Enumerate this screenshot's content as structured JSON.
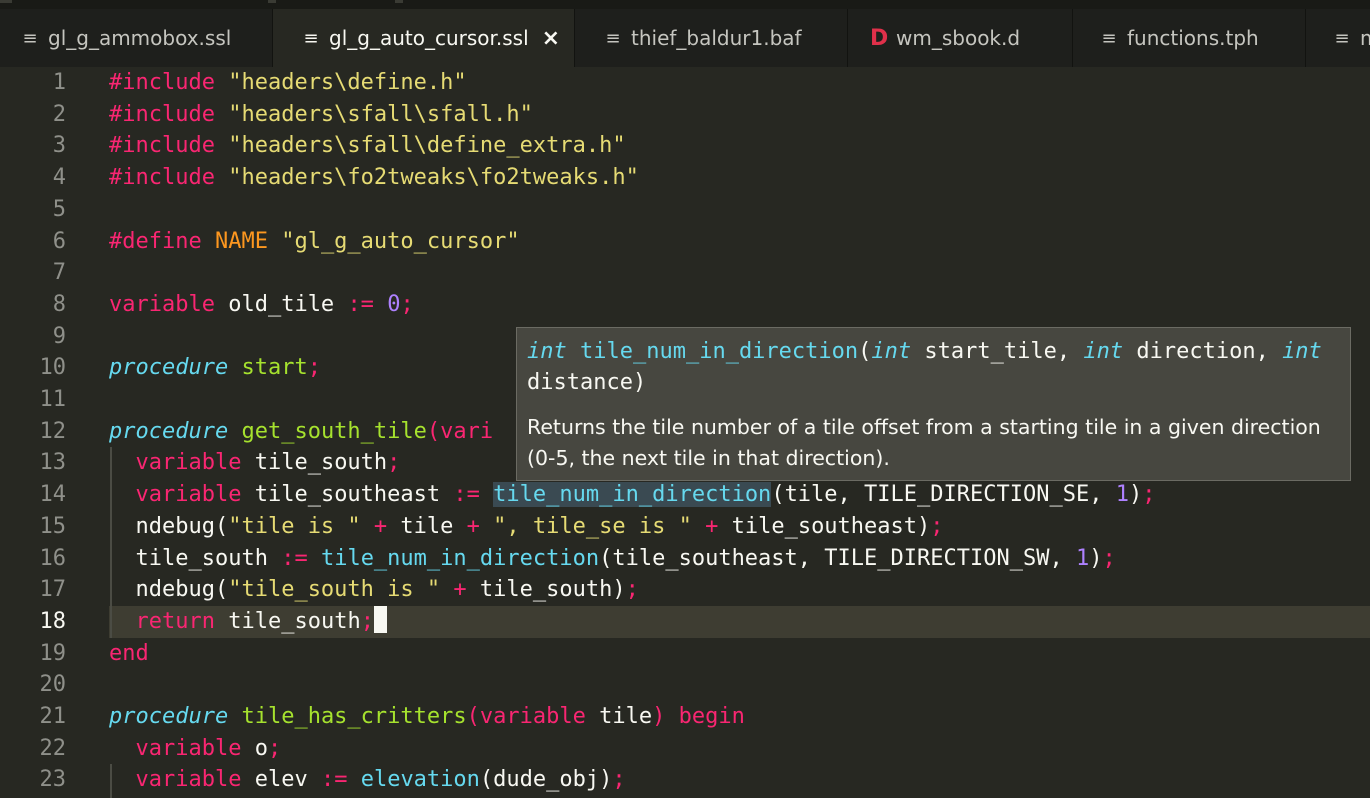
{
  "tabs": [
    {
      "label": "gl_g_ammobox.ssl",
      "active": false
    },
    {
      "label": "gl_g_auto_cursor.ssl",
      "active": true,
      "close": "×"
    },
    {
      "label": "thief_baldur1.baf",
      "active": false
    },
    {
      "label": "wm_sbook.d",
      "active": false,
      "icon_letter": "D"
    },
    {
      "label": "functions.tph",
      "active": false
    },
    {
      "label": "m",
      "active": false
    }
  ],
  "icons": {
    "file": "≡"
  },
  "colors": {
    "background": "#272822",
    "keyword": "#f92672",
    "string": "#e6db74",
    "function": "#66d9ef",
    "number": "#ae81ff",
    "constant": "#fd971f",
    "text": "#f8f8f2"
  },
  "editor": {
    "current_line": 18,
    "lines": [
      {
        "n": "1"
      },
      {
        "n": "2"
      },
      {
        "n": "3"
      },
      {
        "n": "4"
      },
      {
        "n": "5"
      },
      {
        "n": "6"
      },
      {
        "n": "7"
      },
      {
        "n": "8"
      },
      {
        "n": "9"
      },
      {
        "n": "10"
      },
      {
        "n": "11"
      },
      {
        "n": "12"
      },
      {
        "n": "13"
      },
      {
        "n": "14"
      },
      {
        "n": "15"
      },
      {
        "n": "16"
      },
      {
        "n": "17"
      },
      {
        "n": "18"
      },
      {
        "n": "19"
      },
      {
        "n": "20"
      },
      {
        "n": "21"
      },
      {
        "n": "22"
      },
      {
        "n": "23"
      }
    ],
    "code": {
      "include": "#include",
      "h1": "\"headers\\define.h\"",
      "h2": "\"headers\\sfall\\sfall.h\"",
      "h3": "\"headers\\sfall\\define_extra.h\"",
      "h4": "\"headers\\fo2tweaks\\fo2tweaks.h\"",
      "define": "#define",
      "name": "NAME",
      "name_val": "\"gl_g_auto_cursor\"",
      "variable": "variable",
      "procedure": "procedure",
      "old_tile": "old_tile",
      "assign": ":=",
      "zero": "0",
      "one": "1",
      "semi": ";",
      "start": "start",
      "get_south_tile": "get_south_tile",
      "paren_open": "(",
      "vari": "vari",
      "tile_south": "tile_south",
      "tile_southeast": "tile_southeast",
      "tile_num_in_direction": "tile_num_in_direction",
      "args14": "tile, TILE_DIRECTION_SE, ",
      "args16": "tile_southeast, TILE_DIRECTION_SW, ",
      "close_paren": ")",
      "ndebug": "ndebug(",
      "s_tile_is": "\"tile is \"",
      "plus": "+",
      "tile": "tile",
      "s_tile_se_is": "\", tile_se is \"",
      "s_tile_south_is": "\"tile_south is \"",
      "return": "return",
      "end": "end",
      "tile_has_critters": "tile_has_critters",
      "begin": "begin",
      "o": "o",
      "elev": "elev",
      "elevation": "elevation",
      "dude_obj": "dude_obj"
    }
  },
  "popup": {
    "ret_type": "int",
    "fn": "tile_num_in_direction",
    "t1": "int",
    "a1": "start_tile,",
    "t2": "int",
    "a2": "direction,",
    "t3": "int",
    "a3": "distance",
    "description": "Returns the tile number of a tile offset from a starting tile in a given direction (0-5, the next tile in that direction)."
  }
}
